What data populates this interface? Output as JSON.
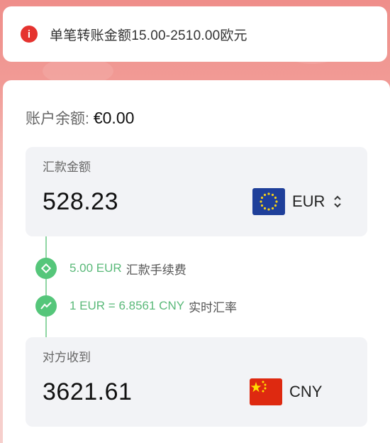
{
  "alert": {
    "icon": "info-icon",
    "text": "单笔转账金额15.00-2510.00欧元"
  },
  "balance": {
    "label": "账户余额:",
    "value": "€0.00"
  },
  "send": {
    "label": "汇款金额",
    "amount": "528.23",
    "currency": "EUR",
    "flag": "eu-flag-icon"
  },
  "fee": {
    "value": "5.00 EUR",
    "label": "汇款手续费"
  },
  "rate": {
    "value": "1 EUR = 6.8561 CNY",
    "label": "实时汇率"
  },
  "receive": {
    "label": "对方收到",
    "amount": "3621.61",
    "currency": "CNY",
    "flag": "china-flag-icon"
  },
  "colors": {
    "accent_green": "#55c67a",
    "alert_red": "#e5332f",
    "header_bg": "#ef8e8a"
  }
}
